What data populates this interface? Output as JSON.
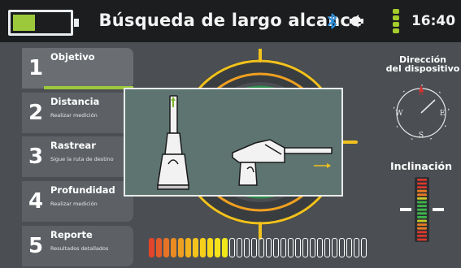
{
  "header": {
    "title": "Búsqueda de largo alcance",
    "time": "16:40",
    "battery_level": 0.4,
    "icons": [
      "battery-icon",
      "bluetooth-icon",
      "volume-icon",
      "signal-icon"
    ]
  },
  "menu": {
    "items": [
      {
        "number": "1",
        "label": "Objetivo",
        "sub": "",
        "active": true
      },
      {
        "number": "2",
        "label": "Distancia",
        "sub": "Realizar medición"
      },
      {
        "number": "3",
        "label": "Rastrear",
        "sub": "Sigue la ruta de destino"
      },
      {
        "number": "4",
        "label": "Profundidad",
        "sub": "Realizar medición"
      },
      {
        "number": "5",
        "label": "Reporte",
        "sub": "Resultados detallados"
      }
    ]
  },
  "right_panel": {
    "direction_title_line1": "Dirección",
    "direction_title_line2": "del dispositivo",
    "compass": {
      "n": "N",
      "e": "E",
      "s": "S",
      "w": "W"
    },
    "tilt_title": "Inclinación"
  },
  "signal_meter": {
    "total_segments": 30,
    "filled_segments": 11
  },
  "colors": {
    "accent_green": "#9cc93b",
    "radar_yellow": "#f2c21c",
    "radar_orange": "#f0a020",
    "compass_red": "#d83030"
  }
}
